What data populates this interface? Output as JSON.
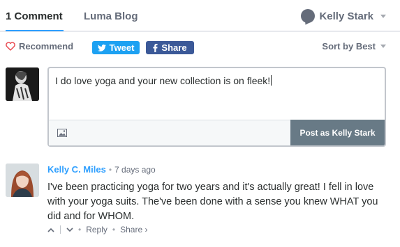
{
  "nav": {
    "comments_tab": "1 Comment",
    "blog_tab": "Luma Blog",
    "user_name": "Kelly Stark"
  },
  "actions": {
    "recommend_label": "Recommend",
    "tweet_label": "Tweet",
    "share_label": "Share",
    "sort_label": "Sort by Best"
  },
  "composer": {
    "text": "I do love yoga and your new collection is on fleek!",
    "post_label": "Post as Kelly Stark"
  },
  "comment": {
    "author": "Kelly C. Miles",
    "separator": "•",
    "time": "7 days ago",
    "body": "I've been practicing yoga for two years and it's actually great! I fell in love with your yoga suits. The've been done with a sense you knew WHAT you did and for WHOM.",
    "reply_label": "Reply",
    "share_label": "Share ›"
  },
  "colors": {
    "accent": "#2e9fff",
    "twitter": "#1da1f2",
    "facebook": "#3b5998",
    "post_button": "#687a86",
    "heart": "#e8424a"
  },
  "icons": {
    "heart": "heart-icon",
    "twitter": "twitter-bird-icon",
    "facebook": "facebook-f-icon",
    "image": "image-icon",
    "upvote": "chevron-up-icon",
    "downvote": "chevron-down-icon",
    "user": "speech-bubble-icon"
  }
}
